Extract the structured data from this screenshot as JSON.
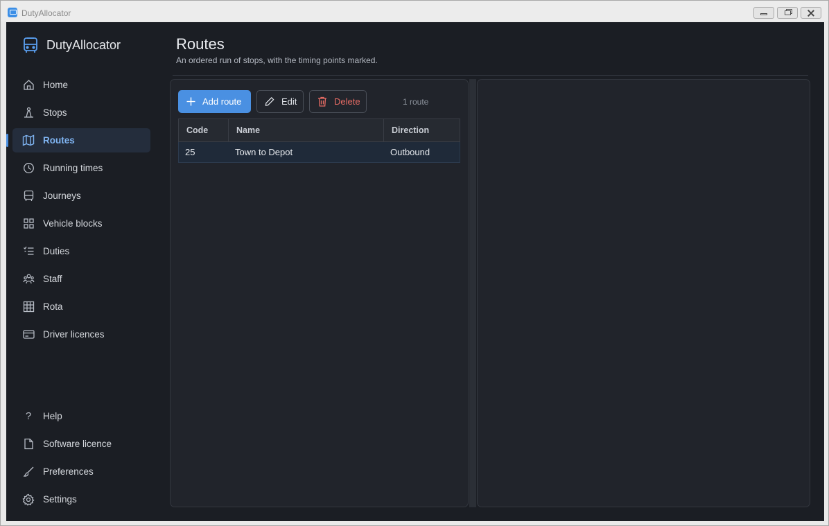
{
  "window": {
    "title": "DutyAllocator"
  },
  "brand": {
    "name": "DutyAllocator"
  },
  "nav": {
    "items": [
      {
        "label": "Home",
        "icon": "home-icon"
      },
      {
        "label": "Stops",
        "icon": "bus-stop-icon"
      },
      {
        "label": "Routes",
        "icon": "map-icon",
        "active": true
      },
      {
        "label": "Running times",
        "icon": "clock-icon"
      },
      {
        "label": "Journeys",
        "icon": "bus-icon"
      },
      {
        "label": "Vehicle blocks",
        "icon": "grid-icon"
      },
      {
        "label": "Duties",
        "icon": "checklist-icon"
      },
      {
        "label": "Staff",
        "icon": "people-icon"
      },
      {
        "label": "Rota",
        "icon": "table-icon"
      },
      {
        "label": "Driver licences",
        "icon": "card-icon"
      }
    ],
    "footer": [
      {
        "label": "Help",
        "icon": "question-icon"
      },
      {
        "label": "Software licence",
        "icon": "document-icon"
      },
      {
        "label": "Preferences",
        "icon": "brush-icon"
      },
      {
        "label": "Settings",
        "icon": "gear-icon"
      }
    ]
  },
  "page": {
    "title": "Routes",
    "subtitle": "An ordered run of stops, with the timing points marked."
  },
  "toolbar": {
    "add_label": "Add route",
    "edit_label": "Edit",
    "delete_label": "Delete",
    "count": "1 route"
  },
  "table": {
    "columns": [
      "Code",
      "Name",
      "Direction"
    ],
    "rows": [
      [
        "25",
        "Town to Depot",
        "Outbound"
      ]
    ]
  },
  "colors": {
    "accent": "#4a90e2",
    "danger": "#e86c64",
    "background": "#1b1e24"
  }
}
